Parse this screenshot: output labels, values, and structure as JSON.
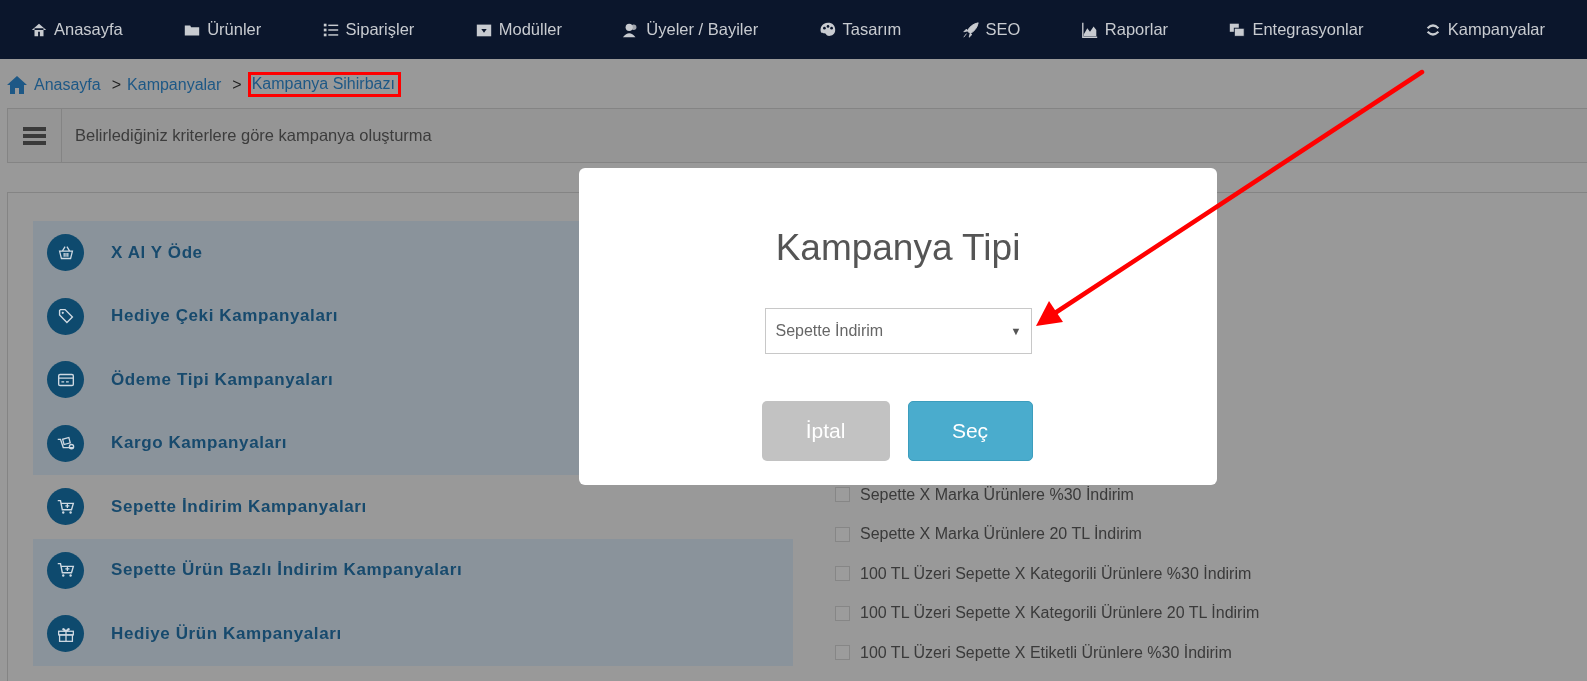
{
  "nav": {
    "items": [
      {
        "label": "Anasayfa"
      },
      {
        "label": "Ürünler"
      },
      {
        "label": "Siparişler"
      },
      {
        "label": "Modüller"
      },
      {
        "label": "Üyeler / Bayiler"
      },
      {
        "label": "Tasarım"
      },
      {
        "label": "SEO"
      },
      {
        "label": "Raporlar"
      },
      {
        "label": "Entegrasyonlar"
      },
      {
        "label": "Kampanyalar"
      }
    ]
  },
  "breadcrumb": [
    {
      "label": "Anasayfa",
      "highlighted": false
    },
    {
      "label": "Kampanyalar",
      "separator": ">",
      "highlighted": false
    },
    {
      "label": "Kampanya Sihirbazı",
      "separator": ">",
      "highlighted": true
    }
  ],
  "header": {
    "title": "Belirlediğiniz kriterlere göre kampanya oluşturma"
  },
  "campaign_types": [
    {
      "label": "X Al Y Öde",
      "selected": false
    },
    {
      "label": "Hediye Çeki Kampanyaları",
      "selected": false
    },
    {
      "label": "Ödeme Tipi Kampanyaları",
      "selected": false
    },
    {
      "label": "Kargo Kampanyaları",
      "selected": false
    },
    {
      "label": "Sepette İndirim Kampanyaları",
      "selected": true
    },
    {
      "label": "Sepette Ürün Bazlı İndirim Kampanyaları",
      "selected": false
    },
    {
      "label": "Hediye Ürün Kampanyaları",
      "selected": false
    }
  ],
  "options": [
    {
      "label": "Sepette X Marka Ürünlere %30 İndirim",
      "checked": false
    },
    {
      "label": "Sepette X Marka Ürünlere 20 TL İndirim",
      "checked": false
    },
    {
      "label": "100 TL Üzeri Sepette X Kategorili Ürünlere %30 İndirim",
      "checked": false
    },
    {
      "label": "100 TL Üzeri Sepette X Kategorili Ürünlere 20 TL İndirim",
      "checked": false
    },
    {
      "label": "100 TL Üzeri Sepette X Etiketli Ürünlere %30 İndirim",
      "checked": false
    }
  ],
  "dialog": {
    "title": "Kampanya Tipi",
    "select": {
      "value": "Sepette İndirim",
      "caret": "▼"
    },
    "buttons": [
      {
        "label": "İptal",
        "kind": "cancel"
      },
      {
        "label": "Seç",
        "kind": "primary"
      }
    ]
  }
}
